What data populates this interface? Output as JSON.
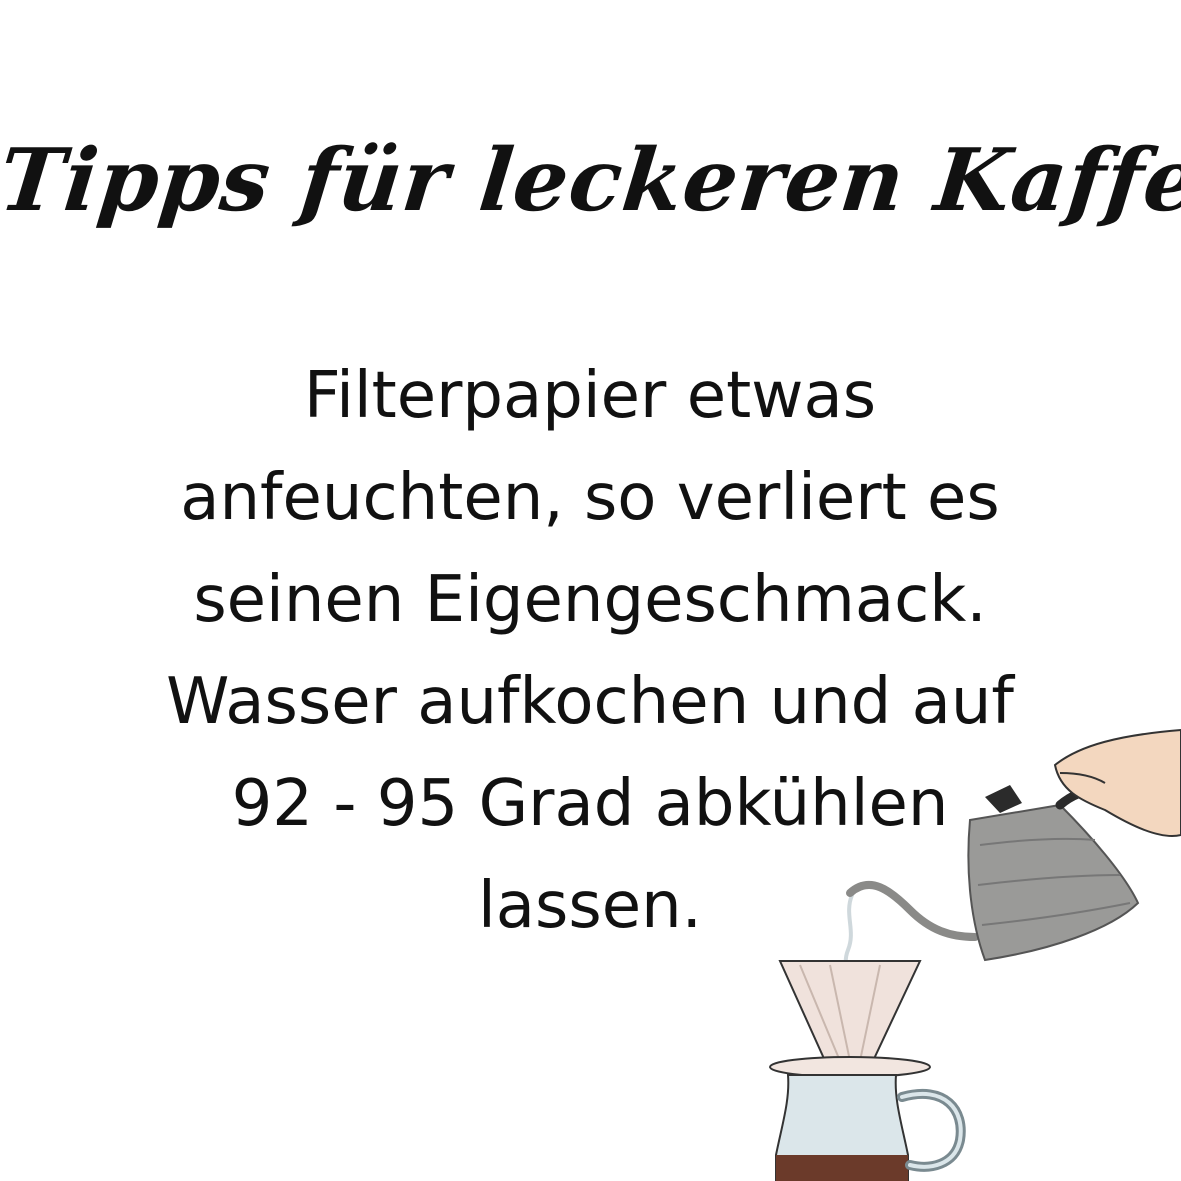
{
  "title": "Tipps für leckeren Kaffee",
  "body": {
    "lines": [
      "Filterpapier etwas",
      "anfeuchten, so verliert es",
      "seinen Eigengeschmack.",
      "Wasser aufkochen und auf",
      "92 - 95 Grad abkühlen",
      "lassen."
    ]
  },
  "colors": {
    "background": "#ffffff",
    "text": "#111111",
    "kettle": "#9a9a98",
    "skin": "#f3d7bf",
    "filter": "#f0e2dc",
    "coffee": "#6b3a2a",
    "glass": "#dbe6ea"
  },
  "illustration": {
    "icon": "pour-over-coffee-icon"
  }
}
